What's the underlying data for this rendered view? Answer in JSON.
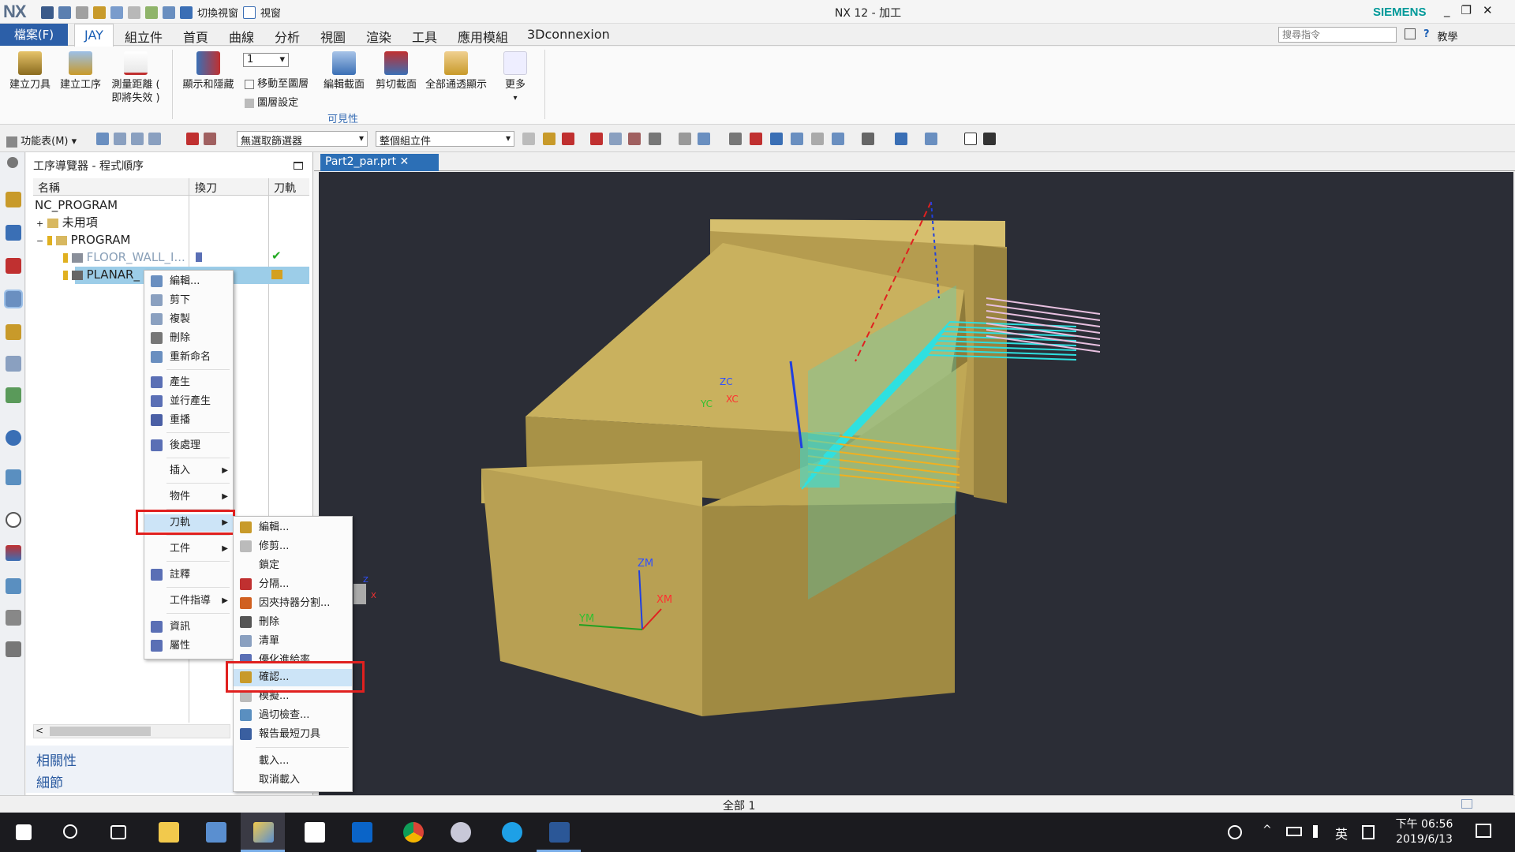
{
  "titlebar": {
    "logo": "NX",
    "switch_view": "切換視窗",
    "window": "視窗",
    "title": "NX 12 - 加工",
    "brand": "SIEMENS",
    "min": "_",
    "restore": "❐",
    "close": "✕"
  },
  "menu": {
    "file": "檔案(F)",
    "tabs": [
      "JAY",
      "組立件",
      "首頁",
      "曲線",
      "分析",
      "視圖",
      "渲染",
      "工具",
      "應用模組",
      "3Dconnexion"
    ],
    "search_placeholder": "搜尋指令",
    "help": "?",
    "teach": "教學"
  },
  "ribbon": {
    "create_tool": "建立刀具",
    "create_operation": "建立工序",
    "measure_l1": "測量距離 (",
    "measure_l2": "即將失效 )",
    "show_hide": "顯示和隱藏",
    "layer_value": "1",
    "move_to_layer": "移動至圖層",
    "layer_settings": "圖層設定",
    "edit_section": "編輯截面",
    "clip_section": "剪切截面",
    "show_all": "全部通透顯示",
    "more": "更多",
    "group_visibility": "可見性"
  },
  "toolbar2": {
    "menu": "功能表(M)",
    "filter": "無選取篩選器",
    "assembly_scope": "整個組立件"
  },
  "navigator": {
    "title": "工序導覽器 - 程式順序",
    "headers": [
      "名稱",
      "換刀",
      "刀軌"
    ],
    "rows": [
      {
        "label": "NC_PROGRAM"
      },
      {
        "label": "未用項"
      },
      {
        "label": "PROGRAM"
      },
      {
        "label": "FLOOR_WALL_I..."
      },
      {
        "label": "PLANAR_"
      }
    ],
    "check": "✔",
    "sections": [
      "相關性",
      "細節"
    ]
  },
  "viewport": {
    "tab": "Part2_par.prt",
    "axes": {
      "zm": "ZM",
      "xm": "XM",
      "ym": "YM",
      "zc": "ZC",
      "xc": "XC",
      "yc": "YC"
    },
    "triad": {
      "z": "Z",
      "x": "X"
    }
  },
  "context_menu": {
    "items": [
      "編輯...",
      "剪下",
      "複製",
      "刪除",
      "重新命名",
      "產生",
      "並行產生",
      "重播",
      "後處理",
      "插入",
      "物件",
      "刀軌",
      "工件",
      "註釋",
      "工件指導",
      "資訊",
      "屬性"
    ]
  },
  "submenu": {
    "items": [
      "編輯...",
      "修剪...",
      "鎖定",
      "分隔...",
      "因夾持器分割...",
      "刪除",
      "清單",
      "優化進給率",
      "確認...",
      "模擬...",
      "過切檢查...",
      "報告最短刀具",
      "載入...",
      "取消載入"
    ]
  },
  "status": {
    "text": "全部 1"
  },
  "taskbar": {
    "time": "下午 06:56",
    "date": "2019/6/13",
    "lang": "英"
  },
  "colors": {
    "accent": "#2c5fa8",
    "highlight": "#cce4f7",
    "red_box": "#e0201f",
    "part": "#c2aa58",
    "toolpath_cyan": "#2fe0e0",
    "toolpath_orange": "#f0b020",
    "viewport_bg": "#2b2d36"
  }
}
